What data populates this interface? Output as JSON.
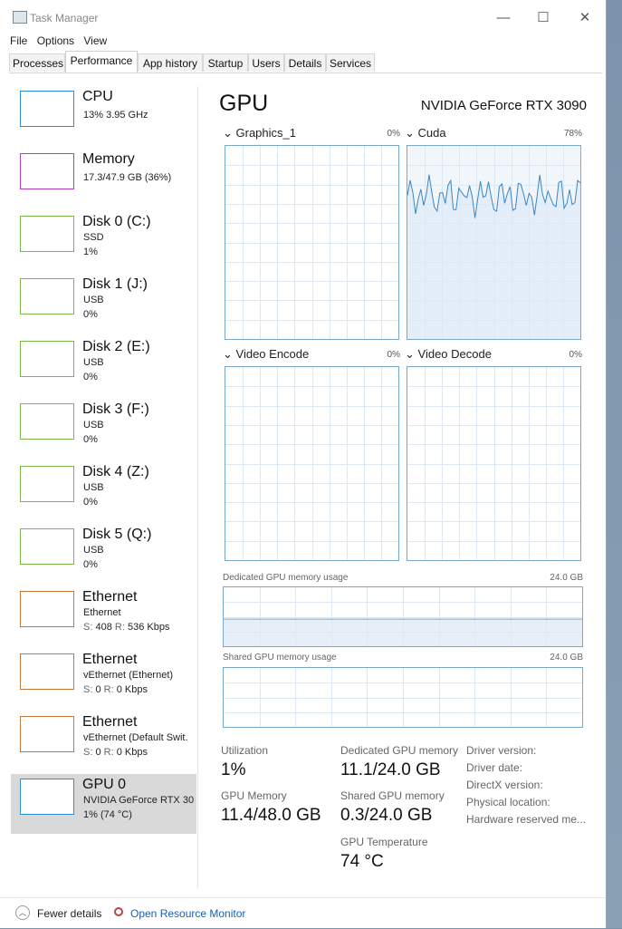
{
  "window": {
    "title": "Task Manager",
    "minimize": "—",
    "maximize": "☐",
    "close": "✕"
  },
  "menu": [
    "File",
    "Options",
    "View"
  ],
  "tabs": [
    "Processes",
    "Performance",
    "App history",
    "Startup",
    "Users",
    "Details",
    "Services"
  ],
  "active_tab": "Performance",
  "sidebar": [
    {
      "name": "CPU",
      "line1": "13%  3.95 GHz",
      "color": "#2a8fd8"
    },
    {
      "name": "Memory",
      "line1": "17.3/47.9 GB (36%)",
      "color": "#b53fc0"
    },
    {
      "name": "Disk 0 (C:)",
      "line1": "SSD",
      "line2": "1%",
      "color": "#7bb64a"
    },
    {
      "name": "Disk 1 (J:)",
      "line1": "USB",
      "line2": "0%",
      "color": "#7bb64a"
    },
    {
      "name": "Disk 2 (E:)",
      "line1": "USB",
      "line2": "0%",
      "color": "#7bb64a"
    },
    {
      "name": "Disk 3 (F:)",
      "line1": "USB",
      "line2": "0%",
      "color": "#7bb64a"
    },
    {
      "name": "Disk 4 (Z:)",
      "line1": "USB",
      "line2": "0%",
      "color": "#7bb64a"
    },
    {
      "name": "Disk 5 (Q:)",
      "line1": "USB",
      "line2": "0%",
      "color": "#7bb64a"
    },
    {
      "name": "Ethernet",
      "line1": "Ethernet",
      "s_label": "S:",
      "s_val": "408",
      "r_label": "R:",
      "r_val": "536 Kbps",
      "color": "#c8773a"
    },
    {
      "name": "Ethernet",
      "line1": "vEthernet (Ethernet)",
      "s_label": "S:",
      "s_val": "0",
      "r_label": "R:",
      "r_val": "0 Kbps",
      "color": "#c8773a"
    },
    {
      "name": "Ethernet",
      "line1": "vEthernet (Default Swit.",
      "s_label": "S:",
      "s_val": "0",
      "r_label": "R:",
      "r_val": "0 Kbps",
      "color": "#c8773a"
    },
    {
      "name": "GPU 0",
      "line1": "NVIDIA GeForce RTX 30",
      "line2": "1% (74 °C)",
      "color": "#2a8fd8"
    }
  ],
  "selected_index": 11,
  "gpu": {
    "title": "GPU",
    "model": "NVIDIA GeForce RTX 3090",
    "engines": [
      {
        "name": "Graphics_1",
        "percent": "0%"
      },
      {
        "name": "Cuda",
        "percent": "78%"
      },
      {
        "name": "Video Encode",
        "percent": "0%"
      },
      {
        "name": "Video Decode",
        "percent": "0%"
      }
    ],
    "dedicated_memory": {
      "label": "Dedicated GPU memory usage",
      "max": "24.0 GB",
      "usage_fraction": 0.46
    },
    "shared_memory": {
      "label": "Shared GPU memory usage",
      "max": "24.0 GB",
      "usage_fraction": 0.0
    },
    "stats": {
      "utilization_label": "Utilization",
      "utilization": "1%",
      "gpu_memory_label": "GPU Memory",
      "gpu_memory": "11.4/48.0 GB",
      "dedicated_label": "Dedicated GPU memory",
      "dedicated": "11.1/24.0 GB",
      "shared_label": "Shared GPU memory",
      "shared": "0.3/24.0 GB",
      "temp_label": "GPU Temperature",
      "temp": "74 °C"
    },
    "info": [
      "Driver version:",
      "Driver date:",
      "DirectX version:",
      "Physical location:",
      "Hardware reserved me..."
    ]
  },
  "footer": {
    "fewer": "Fewer details",
    "monitor": "Open Resource Monitor"
  },
  "accent": "#79a7ce",
  "link_color": "#1a5fb4"
}
